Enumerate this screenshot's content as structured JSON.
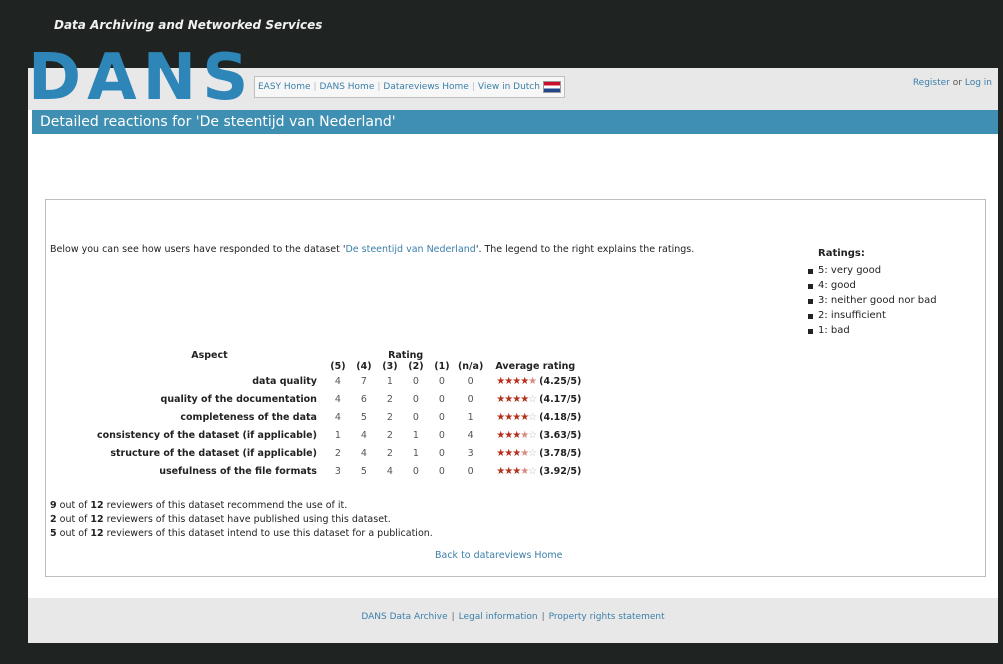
{
  "site": {
    "tagline": "Data Archiving and Networked Services",
    "logo": "DANS"
  },
  "nav": {
    "items": [
      "EASY Home",
      "DANS Home",
      "Datareviews Home",
      "View in Dutch"
    ],
    "flag_icon": "netherlands-flag-icon"
  },
  "auth": {
    "register": "Register",
    "or": "or",
    "login": "Log in"
  },
  "page": {
    "title": "Detailed reactions for 'De steentijd van Nederland'"
  },
  "intro": {
    "before": "Below you can see how users have responded to the dataset '",
    "dataset_link": "De steentijd van Nederland",
    "after": "'. The legend to the right explains the ratings."
  },
  "legend": {
    "title": "Ratings:",
    "items": [
      "5: very good",
      "4: good",
      "3: neither good nor bad",
      "2: insufficient",
      "1: bad"
    ]
  },
  "table": {
    "header_aspect": "Aspect",
    "header_rating": "Rating",
    "columns": [
      "(5)",
      "(4)",
      "(3)",
      "(2)",
      "(1)",
      "(n/a)"
    ],
    "header_average": "Average rating",
    "rows": [
      {
        "aspect": "data quality",
        "counts": [
          4,
          7,
          1,
          0,
          0,
          0
        ],
        "avg": "(4.25/5)",
        "avg_value": 4.25
      },
      {
        "aspect": "quality of the documentation",
        "counts": [
          4,
          6,
          2,
          0,
          0,
          0
        ],
        "avg": "(4.17/5)",
        "avg_value": 4.17
      },
      {
        "aspect": "completeness of the data",
        "counts": [
          4,
          5,
          2,
          0,
          0,
          1
        ],
        "avg": "(4.18/5)",
        "avg_value": 4.18
      },
      {
        "aspect": "consistency of the dataset (if applicable)",
        "counts": [
          1,
          4,
          2,
          1,
          0,
          4
        ],
        "avg": "(3.63/5)",
        "avg_value": 3.63
      },
      {
        "aspect": "structure of the dataset (if applicable)",
        "counts": [
          2,
          4,
          2,
          1,
          0,
          3
        ],
        "avg": "(3.78/5)",
        "avg_value": 3.78
      },
      {
        "aspect": "usefulness of the file formats",
        "counts": [
          3,
          5,
          4,
          0,
          0,
          0
        ],
        "avg": "(3.92/5)",
        "avg_value": 3.92
      }
    ]
  },
  "summary": [
    {
      "count": "9",
      "total": "12",
      "text": " reviewers of this dataset recommend the use of it."
    },
    {
      "count": "2",
      "total": "12",
      "text": " reviewers of this dataset have published using this dataset."
    },
    {
      "count": "5",
      "total": "12",
      "text": " reviewers of this dataset intend to use this dataset for a publication."
    }
  ],
  "summary_out_of": " out of ",
  "back_link": "Back to datareviews Home",
  "footer": {
    "items": [
      "DANS Data Archive",
      "Legal information",
      "Property rights statement"
    ]
  }
}
